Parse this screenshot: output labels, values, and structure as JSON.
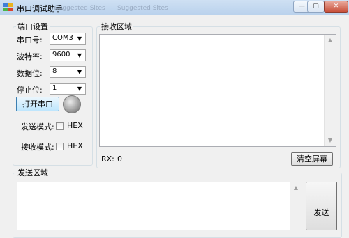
{
  "window": {
    "title": "串口调试助手",
    "ghost_tab_1": "Suggested Sites",
    "ghost_tab_2": "Suggested Sites",
    "minimize": "—",
    "maximize": "▢",
    "close": "✕"
  },
  "port_settings": {
    "title": "端口设置",
    "port_label": "串口号:",
    "port_value": "COM3",
    "baud_label": "波特率:",
    "baud_value": "9600",
    "data_bits_label": "数据位:",
    "data_bits_value": "8",
    "stop_bits_label": "停止位:",
    "stop_bits_value": "1",
    "open_button": "打开串口",
    "send_mode_label": "发送模式:",
    "send_mode_hex": "HEX",
    "recv_mode_label": "接收模式:",
    "recv_mode_hex": "HEX"
  },
  "receive": {
    "title": "接收区域",
    "rx_label": "RX:",
    "rx_count": "0",
    "clear_button": "清空屏幕"
  },
  "send": {
    "title": "发送区域",
    "send_button": "发送"
  },
  "icons": {
    "dropdown": "▼",
    "scroll_up": "▲",
    "scroll_down": "▼"
  },
  "colors": {
    "titlebar": "#c4d9f1",
    "window_bg": "#f0f0f0",
    "close_button": "#c8503a"
  }
}
